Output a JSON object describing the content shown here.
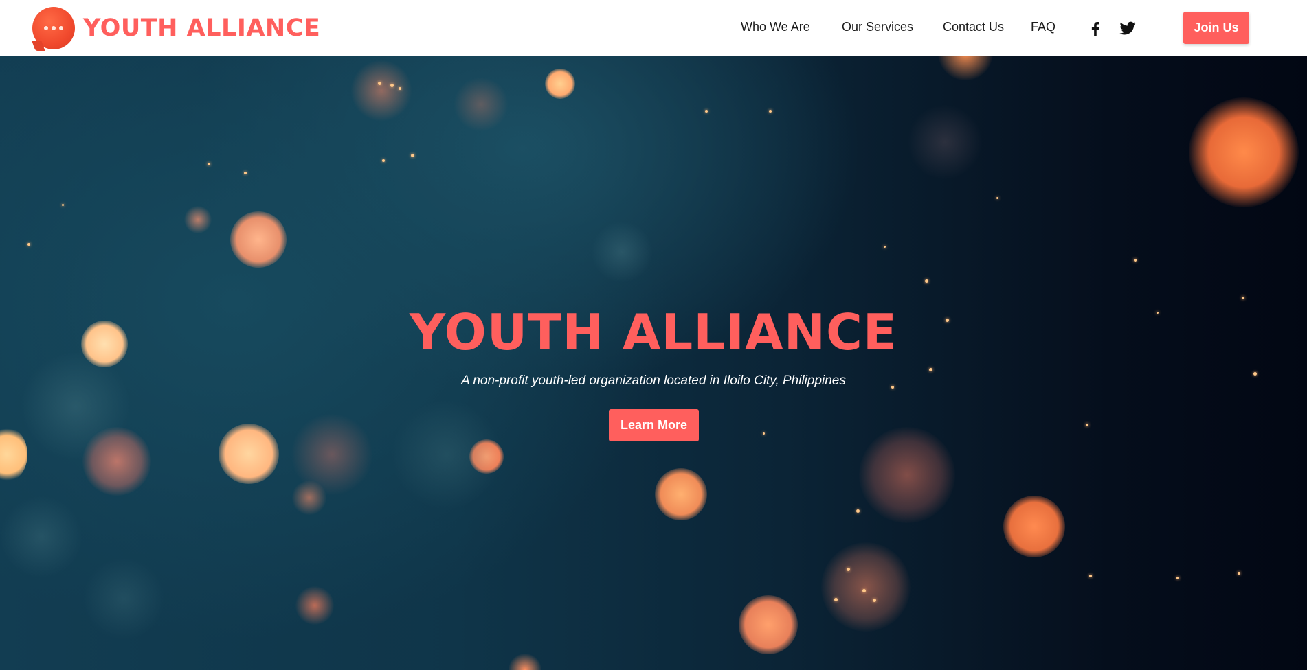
{
  "header": {
    "brand_name": "YOUTH ALLIANCE",
    "nav": [
      {
        "label": "Who We Are"
      },
      {
        "label": "Our Services"
      },
      {
        "label": "Contact Us"
      },
      {
        "label": "FAQ"
      }
    ],
    "social": [
      {
        "icon": "facebook-icon"
      },
      {
        "icon": "twitter-icon"
      }
    ],
    "join_label": "Join Us"
  },
  "hero": {
    "title": "YOUTH ALLIANCE",
    "subtitle": "A non-profit youth-led organization located in Iloilo City, Philippines",
    "cta_label": "Learn More"
  },
  "colors": {
    "accent": "#ff5f5d",
    "header_bg": "#ffffff",
    "nav_text": "#1c1c1c",
    "hero_bg_left": "#123d52",
    "hero_bg_right": "#020713"
  }
}
